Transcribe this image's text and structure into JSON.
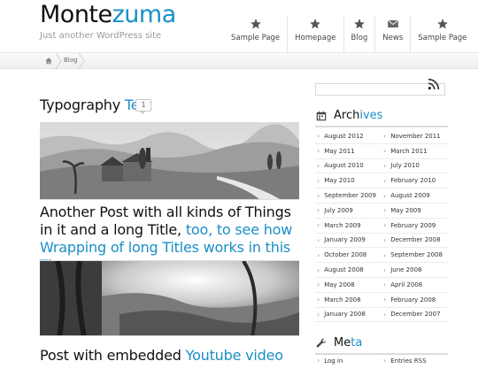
{
  "site": {
    "title_part1": "Monte",
    "title_part2": "zuma",
    "tagline": "Just another WordPress site"
  },
  "nav": {
    "items": [
      {
        "label": "Sample Page",
        "icon": "star-icon"
      },
      {
        "label": "Homepage",
        "icon": "star-icon"
      },
      {
        "label": "Blog",
        "icon": "star-icon"
      },
      {
        "label": "News",
        "icon": "envelope-icon"
      },
      {
        "label": "Sample Page",
        "icon": "star-icon"
      }
    ]
  },
  "breadcrumb": {
    "home_icon": "home-icon",
    "current": "Blog"
  },
  "posts": [
    {
      "title_plain": "Typography ",
      "title_highlight": "Test",
      "comments": "1"
    },
    {
      "title_plain": "Another Post with all kinds of Things in it and a long Title,",
      "title_highlight": " too, to see how Wrapping of long Titles works in this Theme"
    },
    {
      "title_plain": "Post with embedded ",
      "title_highlight": "Youtube video"
    }
  ],
  "sidebar": {
    "archives": {
      "title_plain": "Arch",
      "title_highlight": "ives",
      "icon": "calendar-icon",
      "rows": [
        [
          "August 2012",
          "November 2011"
        ],
        [
          "May 2011",
          "March 2011"
        ],
        [
          "August 2010",
          "July 2010"
        ],
        [
          "May 2010",
          "February 2010"
        ],
        [
          "September 2009",
          "August 2009"
        ],
        [
          "July 2009",
          "May 2009"
        ],
        [
          "March 2009",
          "February 2009"
        ],
        [
          "January 2009",
          "December 2008"
        ],
        [
          "October 2008",
          "September 2008"
        ],
        [
          "August 2008",
          "June 2008"
        ],
        [
          "May 2008",
          "April 2008"
        ],
        [
          "March 2008",
          "February 2008"
        ],
        [
          "January 2008",
          "December 2007"
        ]
      ]
    },
    "meta": {
      "title_plain": "Me",
      "title_highlight": "ta",
      "icon": "wrench-icon",
      "items": [
        "Log in",
        "Entries RSS"
      ]
    }
  },
  "colors": {
    "accent": "#1a8fc8"
  }
}
